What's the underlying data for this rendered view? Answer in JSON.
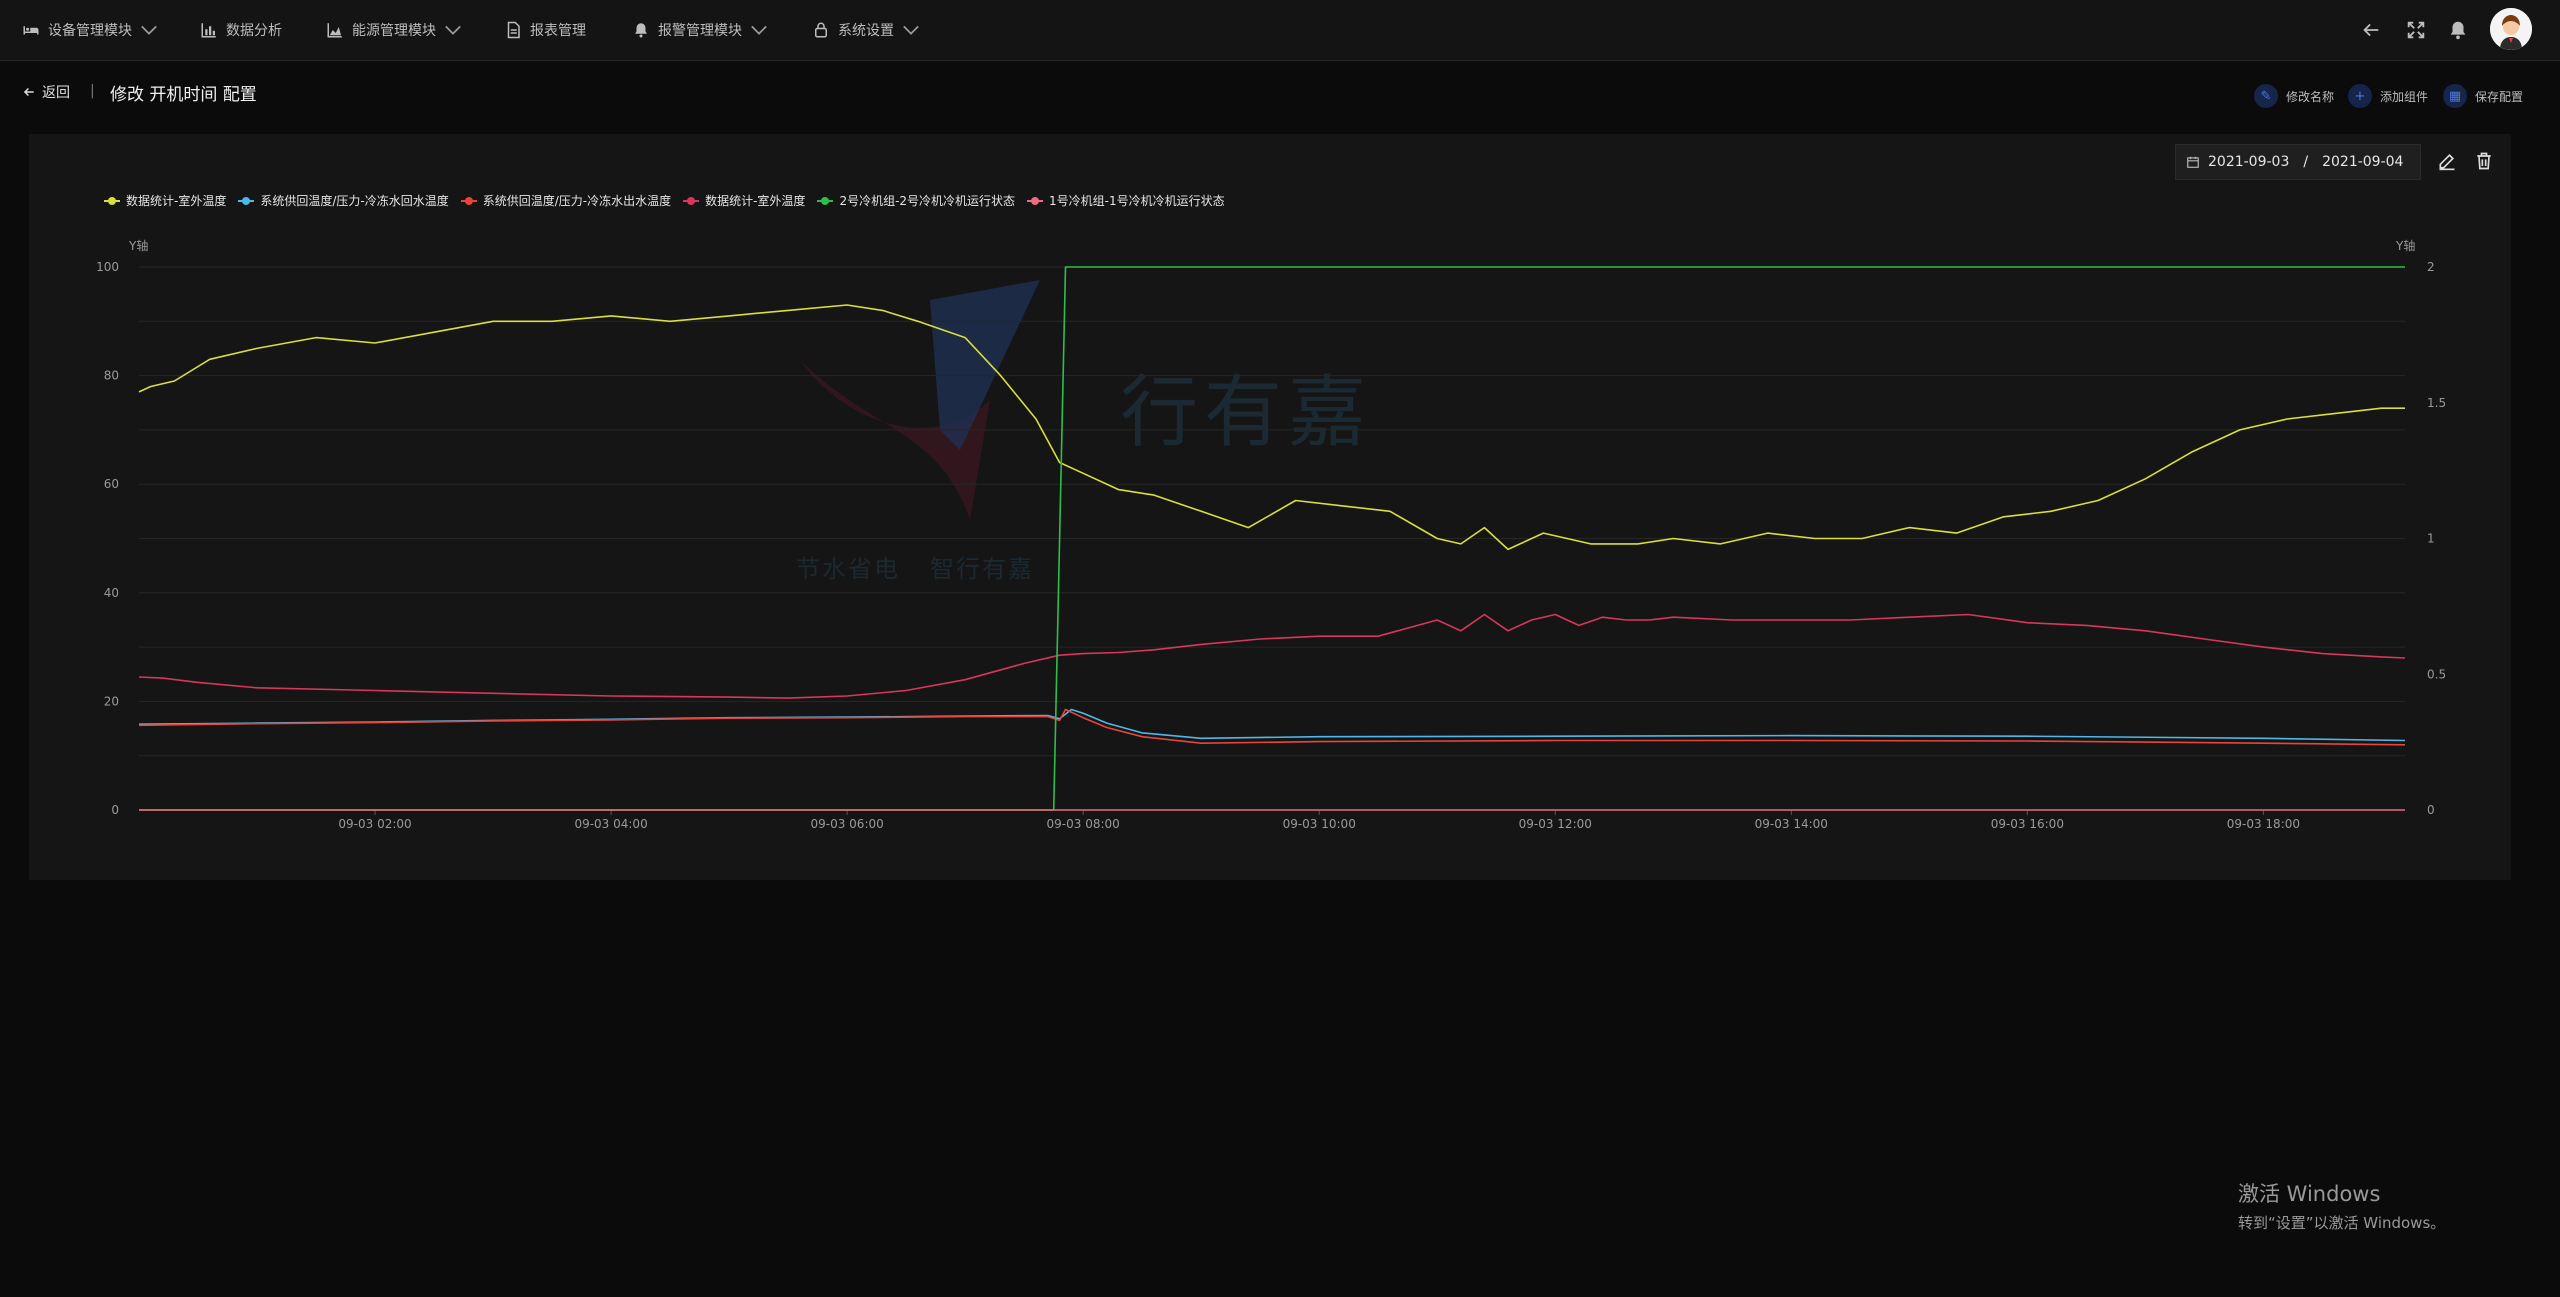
{
  "nav": {
    "items": [
      {
        "label": "设备管理模块",
        "icon": "bed-icon",
        "dropdown": true
      },
      {
        "label": "数据分析",
        "icon": "bar-chart-icon",
        "dropdown": false
      },
      {
        "label": "能源管理模块",
        "icon": "area-chart-icon",
        "dropdown": true
      },
      {
        "label": "报表管理",
        "icon": "document-icon",
        "dropdown": false
      },
      {
        "label": "报警管理模块",
        "icon": "bell-icon",
        "dropdown": true
      },
      {
        "label": "系统设置",
        "icon": "lock-icon",
        "dropdown": true
      }
    ],
    "right_icons": [
      "back-arrow-icon",
      "fullscreen-icon",
      "notification-icon",
      "user-avatar"
    ]
  },
  "header": {
    "back_label": "返回",
    "separator": "|",
    "title": "修改 开机时间 配置",
    "actions": [
      {
        "label": "修改名称",
        "icon": "edit-icon"
      },
      {
        "label": "添加组件",
        "icon": "plus-icon"
      },
      {
        "label": "保存配置",
        "icon": "save-icon"
      }
    ]
  },
  "panel": {
    "date_start": "2021-09-03",
    "date_sep": "/",
    "date_end": "2021-09-04",
    "tools": [
      "edit-icon",
      "delete-icon"
    ]
  },
  "watermark": {
    "brand": "行有嘉",
    "slogan1": "节水省电",
    "slogan2": "智行有嘉"
  },
  "chart_data": {
    "type": "line",
    "legend_position": "top-left",
    "grid": true,
    "left_axis": {
      "label": "Y轴",
      "ylim": [
        0,
        100
      ],
      "ticks": [
        "0",
        "20",
        "40",
        "60",
        "80",
        "100"
      ]
    },
    "right_axis": {
      "label": "Y轴",
      "ylim": [
        0,
        2
      ],
      "ticks": [
        "0",
        "0.5",
        "1",
        "1.5",
        "2"
      ]
    },
    "x_range_hours": [
      0,
      19.2
    ],
    "x_ticks": [
      "09-03 02:00",
      "09-03 04:00",
      "09-03 06:00",
      "09-03 08:00",
      "09-03 10:00",
      "09-03 12:00",
      "09-03 14:00",
      "09-03 16:00",
      "09-03 18:00"
    ],
    "x_tick_hours": [
      2,
      4,
      6,
      8,
      10,
      12,
      14,
      16,
      18
    ],
    "series": [
      {
        "name": "数据统计-室外温度",
        "color": "#d8e03a",
        "axis": "left",
        "x": [
          0,
          0.1,
          0.3,
          0.6,
          1,
          1.5,
          2,
          2.5,
          3,
          3.5,
          4,
          4.5,
          5,
          5.5,
          6,
          6.3,
          6.6,
          7,
          7.3,
          7.6,
          7.8,
          8,
          8.3,
          8.6,
          9,
          9.4,
          9.8,
          10.2,
          10.6,
          11,
          11.2,
          11.4,
          11.6,
          11.9,
          12.3,
          12.7,
          13,
          13.4,
          13.8,
          14.2,
          14.6,
          15,
          15.4,
          15.8,
          16.2,
          16.6,
          17,
          17.4,
          17.8,
          18.2,
          18.6,
          19,
          19.2
        ],
        "y": [
          77,
          78,
          79,
          83,
          85,
          87,
          86,
          88,
          90,
          90,
          91,
          90,
          91,
          92,
          93,
          92,
          90,
          87,
          80,
          72,
          64,
          62,
          59,
          58,
          55,
          52,
          57,
          56,
          55,
          50,
          49,
          52,
          48,
          51,
          49,
          49,
          50,
          49,
          51,
          50,
          50,
          52,
          51,
          54,
          55,
          57,
          61,
          66,
          70,
          72,
          73,
          74,
          74
        ]
      },
      {
        "name": "系统供回温度/压力-冷冻水回水温度",
        "color": "#4fb8e8",
        "axis": "left",
        "x": [
          0,
          1,
          2,
          3,
          4,
          5,
          6,
          7,
          7.7,
          7.8,
          7.9,
          8.0,
          8.2,
          8.5,
          9,
          10,
          12,
          14,
          16,
          18,
          19.2
        ],
        "y": [
          15.8,
          16.0,
          16.2,
          16.5,
          16.7,
          17.0,
          17.1,
          17.3,
          17.4,
          16.8,
          18.5,
          17.8,
          16.0,
          14.2,
          13.2,
          13.5,
          13.6,
          13.7,
          13.6,
          13.2,
          12.8
        ]
      },
      {
        "name": "系统供回温度/压力-冷冻水出水温度",
        "color": "#e8453a",
        "axis": "left",
        "x": [
          0,
          1,
          2,
          3,
          4,
          5,
          6,
          7,
          7.7,
          7.8,
          7.85,
          8.0,
          8.2,
          8.5,
          9,
          10,
          12,
          14,
          16,
          18,
          19.2
        ],
        "y": [
          15.6,
          15.9,
          16.1,
          16.4,
          16.6,
          16.9,
          17.0,
          17.2,
          17.2,
          16.5,
          18.5,
          17.0,
          15.2,
          13.5,
          12.3,
          12.6,
          12.8,
          12.8,
          12.7,
          12.3,
          12.0
        ]
      },
      {
        "name": "数据统计-室外温度",
        "color": "#d9365c",
        "axis": "left",
        "x": [
          0,
          0.2,
          0.5,
          1,
          2,
          3,
          4,
          5,
          5.5,
          6,
          6.5,
          7,
          7.5,
          7.8,
          8,
          8.3,
          8.6,
          9,
          9.5,
          10,
          10.5,
          11,
          11.2,
          11.4,
          11.6,
          11.8,
          12,
          12.2,
          12.4,
          12.6,
          12.8,
          13,
          13.5,
          14,
          14.5,
          15,
          15.5,
          16,
          16.5,
          17,
          17.5,
          18,
          18.5,
          19,
          19.2
        ],
        "y": [
          24.5,
          24.3,
          23.5,
          22.5,
          22.0,
          21.5,
          21.0,
          20.8,
          20.6,
          21.0,
          22.0,
          24.0,
          27.0,
          28.5,
          28.8,
          29.0,
          29.5,
          30.5,
          31.5,
          32.0,
          32.0,
          35.0,
          33.0,
          36.0,
          33.0,
          35.0,
          36.0,
          34.0,
          35.5,
          35.0,
          35.0,
          35.5,
          35.0,
          35.0,
          35.0,
          35.5,
          36.0,
          34.5,
          34.0,
          33.0,
          31.5,
          30.0,
          28.8,
          28.2,
          28.0
        ]
      },
      {
        "name": "2号冷机组-2号冷机冷机运行状态",
        "color": "#2cc04a",
        "axis": "right",
        "step": true,
        "x": [
          0,
          7.75,
          7.75,
          7.85,
          7.85,
          19.2
        ],
        "y": [
          0,
          0,
          0,
          2,
          2,
          2
        ]
      },
      {
        "name": "1号冷机组-1号冷机冷机运行状态",
        "color": "#f06a80",
        "axis": "right",
        "step": true,
        "x": [
          0,
          19.2
        ],
        "y": [
          0,
          0
        ]
      }
    ]
  }
}
